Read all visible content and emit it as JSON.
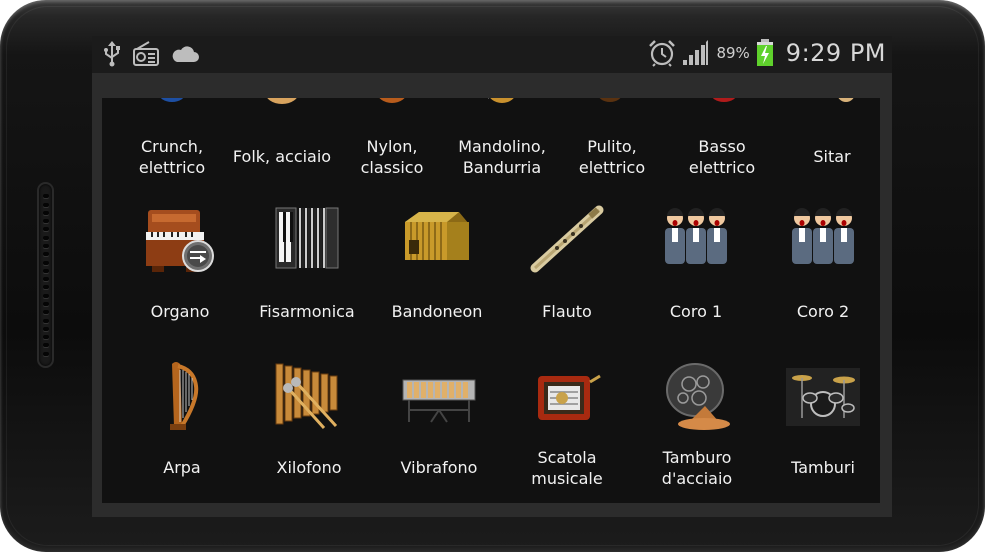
{
  "status_bar": {
    "battery_percent": "89%",
    "time": "9:29 PM",
    "left_icons": [
      "usb-icon",
      "radio-icon",
      "cloud-icon"
    ],
    "right_icons": [
      "alarm-clock-icon",
      "signal-strength-icon",
      "battery-charging-icon"
    ]
  },
  "instruments": {
    "row1": [
      {
        "name": "Crunch,",
        "name2": "elettrico",
        "icon": "electric-guitar-crunch-icon"
      },
      {
        "name": "Folk, acciaio",
        "name2": "",
        "icon": "folk-guitar-icon"
      },
      {
        "name": "Nylon,",
        "name2": "classico",
        "icon": "nylon-guitar-icon"
      },
      {
        "name": "Mandolino,",
        "name2": "Bandurria",
        "icon": "mandolin-icon"
      },
      {
        "name": "Pulito,",
        "name2": "elettrico",
        "icon": "clean-electric-guitar-icon"
      },
      {
        "name": "Basso",
        "name2": "elettrico",
        "icon": "electric-bass-icon"
      },
      {
        "name": "Sitar",
        "name2": "",
        "icon": "sitar-icon"
      }
    ],
    "row2": [
      {
        "name": "Organo",
        "icon": "organ-icon"
      },
      {
        "name": "Fisarmonica",
        "icon": "accordion-icon"
      },
      {
        "name": "Bandoneon",
        "icon": "bandoneon-icon"
      },
      {
        "name": "Flauto",
        "icon": "flute-icon"
      },
      {
        "name": "Coro 1",
        "icon": "choir-icon"
      },
      {
        "name": "Coro 2",
        "icon": "choir-icon"
      }
    ],
    "row3": [
      {
        "name": "Arpa",
        "name2": "",
        "icon": "harp-icon"
      },
      {
        "name": "Xilofono",
        "name2": "",
        "icon": "xylophone-icon"
      },
      {
        "name": "Vibrafono",
        "name2": "",
        "icon": "vibraphone-icon"
      },
      {
        "name": "Scatola",
        "name2": "musicale",
        "icon": "music-box-icon"
      },
      {
        "name": "Tamburo",
        "name2": "d'acciaio",
        "icon": "steel-drum-icon"
      },
      {
        "name": "Tamburi",
        "name2": "",
        "icon": "drum-kit-icon"
      }
    ]
  },
  "colors": {
    "screen_bg": "#2c2c2c",
    "content_bg": "#111111",
    "status_bar_bg": "#1b1b1b",
    "label_text": "#f2f2f2",
    "battery_green": "#5fd12c"
  }
}
